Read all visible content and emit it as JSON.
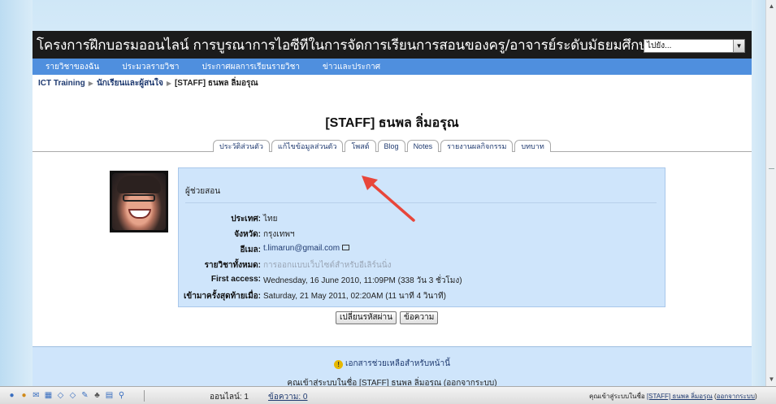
{
  "header": {
    "site_title": "โครงการฝึกบอรมออนไลน์ การบูรณาการไอซีทีในการจัดการเรียนการสอนของครู/อาจารย์ระดับมัธยมศึกษา",
    "jump_select": "ไปยัง..."
  },
  "nav": {
    "items": [
      "รายวิชาของฉัน",
      "ประมวลรายวิชา",
      "ประกาศผลการเรียนรายวิชา",
      "ข่าวและประกาศ"
    ]
  },
  "breadcrumb": {
    "items": [
      "ICT Training",
      "นักเรียนและผู้สนใจ",
      "[STAFF] ธนพล ลิ่มอรุณ"
    ]
  },
  "profile": {
    "name": "[STAFF] ธนพล ลิ่มอรุณ",
    "role": "ผู้ช่วยสอน",
    "country_label": "ประเทศ:",
    "country": "ไทย",
    "city_label": "จังหวัด:",
    "city": "กรุงเทพฯ",
    "email_label": "อีเมล:",
    "email": "t.limarun@gmail.com",
    "courses_label": "รายวิชาทั้งหมด:",
    "courses": "การออกแบบเว็บไซต์สำหรับอีเลิร์นนิ่ง",
    "first_access_label": "First access:",
    "first_access": "Wednesday, 16 June 2010, 11:09PM  (338 วัน 3 ชั่วโมง)",
    "last_access_label": "เข้ามาครั้งสุดท้ายเมื่อ:",
    "last_access": "Saturday, 21 May 2011, 02:20AM  (11 นาที 4 วินาที)"
  },
  "tabs": [
    "ประวัติส่วนตัว",
    "แก้ไขข้อมูลส่วนตัว",
    "โพสต์",
    "Blog",
    "Notes",
    "รายงานผลกิจกรรม",
    "บทบาท"
  ],
  "buttons": {
    "change_password": "เปลี่ยนรหัสผ่าน",
    "message": "ข้อความ"
  },
  "footer": {
    "help": "เอกสารช่วยเหลือสำหรับหน้านี้",
    "login_info": "คุณเข้าสู่ระบบในชื่อ [STAFF] ธนพล ลิ่มอรุณ (ออกจากระบบ)"
  },
  "statusbar": {
    "online": "ออนไลน์: 1",
    "messages": "ข้อความ: 0",
    "login_prefix": "คุณเข้าสู่ระบบในชื่อ",
    "login_name": "[STAFF] ธนพล ลิ่มอรุณ",
    "logout": "ออกจากระบบ"
  },
  "colors": {
    "header_bg": "#1b1b1b",
    "nav_bg": "#4f8fde",
    "panel_bg": "#cfe5fb",
    "annotation_arrow": "#e8463a"
  }
}
